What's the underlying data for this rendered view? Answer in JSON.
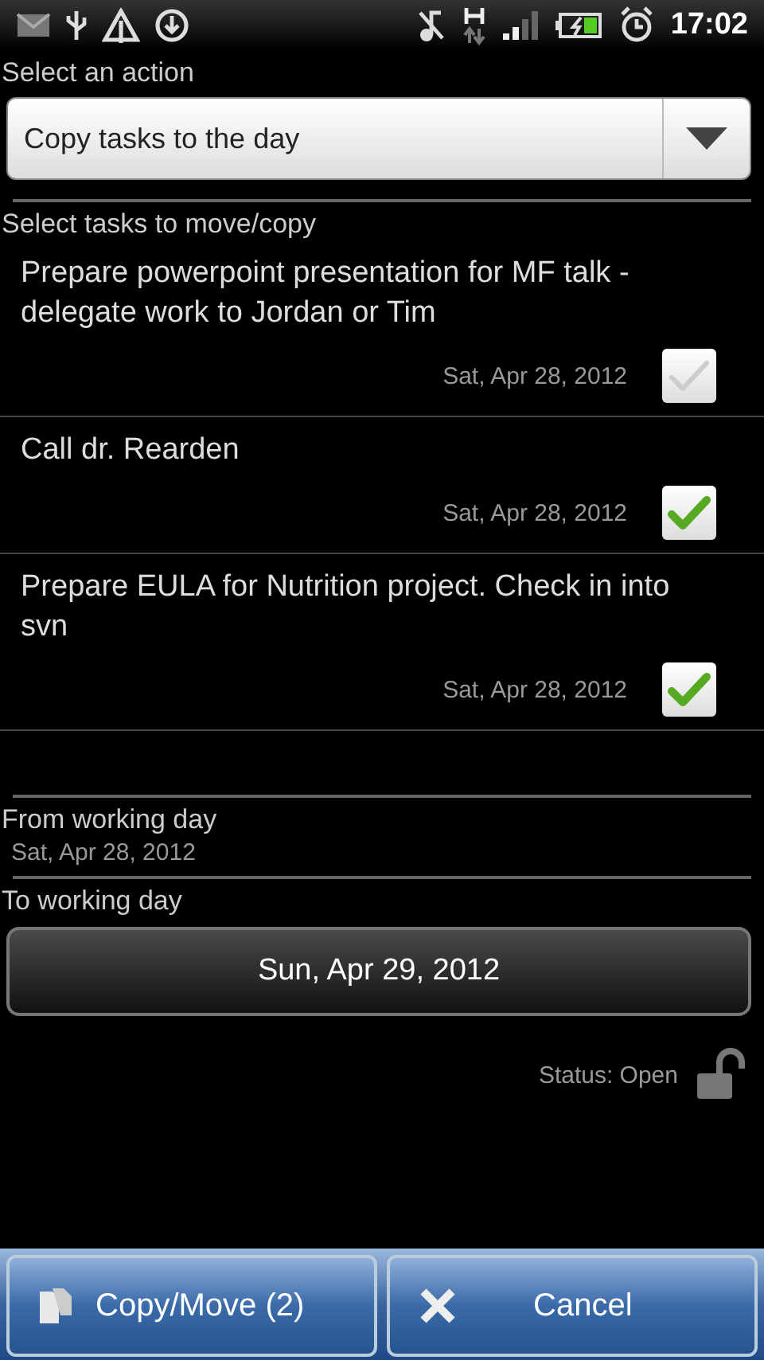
{
  "status_bar": {
    "time": "17:02"
  },
  "action": {
    "label": "Select an action",
    "value": "Copy tasks to the day"
  },
  "tasks_label": "Select tasks to move/copy",
  "tasks": [
    {
      "title": "Prepare powerpoint presentation for MF talk - delegate work to Jordan or Tim",
      "date": "Sat, Apr 28, 2012",
      "checked": false
    },
    {
      "title": "Call dr. Rearden",
      "date": "Sat, Apr 28, 2012",
      "checked": true
    },
    {
      "title": "Prepare EULA for Nutrition project. Check in into svn",
      "date": "Sat, Apr 28, 2012",
      "checked": true
    }
  ],
  "from": {
    "label": "From working day",
    "value": "Sat, Apr 28, 2012"
  },
  "to": {
    "label": "To working day",
    "value": "Sun, Apr 29, 2012"
  },
  "status": {
    "text": "Status: Open",
    "locked": false
  },
  "buttons": [
    {
      "kind": "copy",
      "label": "Copy/Move (2)"
    },
    {
      "kind": "cancel",
      "label": "Cancel"
    }
  ]
}
